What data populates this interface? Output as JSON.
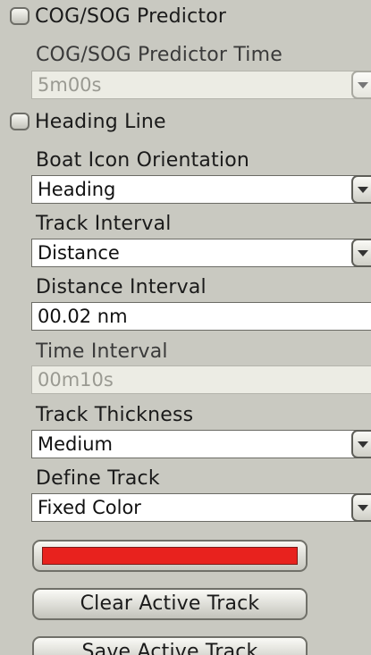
{
  "settings": {
    "cog_sog_predictor": {
      "label": "COG/SOG Predictor",
      "checked": false
    },
    "cog_sog_predictor_time": {
      "label": "COG/SOG Predictor Time",
      "value": "5m00s",
      "enabled": false
    },
    "heading_line": {
      "label": "Heading Line",
      "checked": false
    },
    "boat_icon_orientation": {
      "label": "Boat Icon Orientation",
      "value": "Heading"
    },
    "track_interval": {
      "label": "Track Interval",
      "value": "Distance"
    },
    "distance_interval": {
      "label": "Distance Interval",
      "value": "00.02 nm"
    },
    "time_interval": {
      "label": "Time Interval",
      "value": "00m10s",
      "enabled": false
    },
    "track_thickness": {
      "label": "Track Thickness",
      "value": "Medium"
    },
    "define_track": {
      "label": "Define Track",
      "value": "Fixed Color"
    },
    "track_color": "#e8221e"
  },
  "buttons": {
    "clear_active_track": "Clear Active Track",
    "save_active_track": "Save Active Track"
  }
}
